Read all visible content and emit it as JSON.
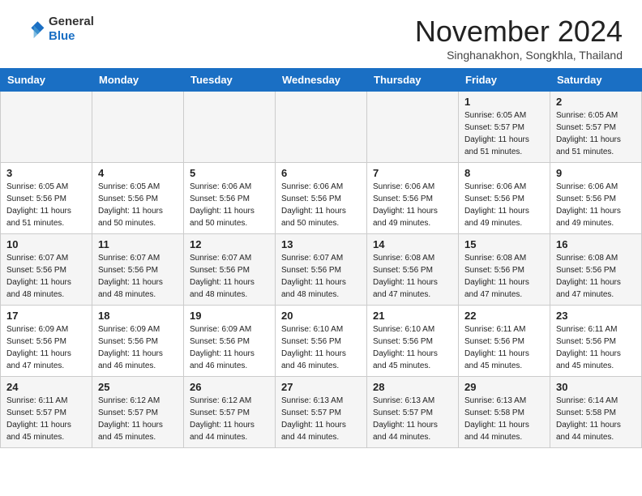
{
  "header": {
    "logo_line1": "General",
    "logo_line2": "Blue",
    "month_title": "November 2024",
    "subtitle": "Singhanakhon, Songkhla, Thailand"
  },
  "weekdays": [
    "Sunday",
    "Monday",
    "Tuesday",
    "Wednesday",
    "Thursday",
    "Friday",
    "Saturday"
  ],
  "weeks": [
    [
      {
        "day": "",
        "info": ""
      },
      {
        "day": "",
        "info": ""
      },
      {
        "day": "",
        "info": ""
      },
      {
        "day": "",
        "info": ""
      },
      {
        "day": "",
        "info": ""
      },
      {
        "day": "1",
        "info": "Sunrise: 6:05 AM\nSunset: 5:57 PM\nDaylight: 11 hours\nand 51 minutes."
      },
      {
        "day": "2",
        "info": "Sunrise: 6:05 AM\nSunset: 5:57 PM\nDaylight: 11 hours\nand 51 minutes."
      }
    ],
    [
      {
        "day": "3",
        "info": "Sunrise: 6:05 AM\nSunset: 5:56 PM\nDaylight: 11 hours\nand 51 minutes."
      },
      {
        "day": "4",
        "info": "Sunrise: 6:05 AM\nSunset: 5:56 PM\nDaylight: 11 hours\nand 50 minutes."
      },
      {
        "day": "5",
        "info": "Sunrise: 6:06 AM\nSunset: 5:56 PM\nDaylight: 11 hours\nand 50 minutes."
      },
      {
        "day": "6",
        "info": "Sunrise: 6:06 AM\nSunset: 5:56 PM\nDaylight: 11 hours\nand 50 minutes."
      },
      {
        "day": "7",
        "info": "Sunrise: 6:06 AM\nSunset: 5:56 PM\nDaylight: 11 hours\nand 49 minutes."
      },
      {
        "day": "8",
        "info": "Sunrise: 6:06 AM\nSunset: 5:56 PM\nDaylight: 11 hours\nand 49 minutes."
      },
      {
        "day": "9",
        "info": "Sunrise: 6:06 AM\nSunset: 5:56 PM\nDaylight: 11 hours\nand 49 minutes."
      }
    ],
    [
      {
        "day": "10",
        "info": "Sunrise: 6:07 AM\nSunset: 5:56 PM\nDaylight: 11 hours\nand 48 minutes."
      },
      {
        "day": "11",
        "info": "Sunrise: 6:07 AM\nSunset: 5:56 PM\nDaylight: 11 hours\nand 48 minutes."
      },
      {
        "day": "12",
        "info": "Sunrise: 6:07 AM\nSunset: 5:56 PM\nDaylight: 11 hours\nand 48 minutes."
      },
      {
        "day": "13",
        "info": "Sunrise: 6:07 AM\nSunset: 5:56 PM\nDaylight: 11 hours\nand 48 minutes."
      },
      {
        "day": "14",
        "info": "Sunrise: 6:08 AM\nSunset: 5:56 PM\nDaylight: 11 hours\nand 47 minutes."
      },
      {
        "day": "15",
        "info": "Sunrise: 6:08 AM\nSunset: 5:56 PM\nDaylight: 11 hours\nand 47 minutes."
      },
      {
        "day": "16",
        "info": "Sunrise: 6:08 AM\nSunset: 5:56 PM\nDaylight: 11 hours\nand 47 minutes."
      }
    ],
    [
      {
        "day": "17",
        "info": "Sunrise: 6:09 AM\nSunset: 5:56 PM\nDaylight: 11 hours\nand 47 minutes."
      },
      {
        "day": "18",
        "info": "Sunrise: 6:09 AM\nSunset: 5:56 PM\nDaylight: 11 hours\nand 46 minutes."
      },
      {
        "day": "19",
        "info": "Sunrise: 6:09 AM\nSunset: 5:56 PM\nDaylight: 11 hours\nand 46 minutes."
      },
      {
        "day": "20",
        "info": "Sunrise: 6:10 AM\nSunset: 5:56 PM\nDaylight: 11 hours\nand 46 minutes."
      },
      {
        "day": "21",
        "info": "Sunrise: 6:10 AM\nSunset: 5:56 PM\nDaylight: 11 hours\nand 45 minutes."
      },
      {
        "day": "22",
        "info": "Sunrise: 6:11 AM\nSunset: 5:56 PM\nDaylight: 11 hours\nand 45 minutes."
      },
      {
        "day": "23",
        "info": "Sunrise: 6:11 AM\nSunset: 5:56 PM\nDaylight: 11 hours\nand 45 minutes."
      }
    ],
    [
      {
        "day": "24",
        "info": "Sunrise: 6:11 AM\nSunset: 5:57 PM\nDaylight: 11 hours\nand 45 minutes."
      },
      {
        "day": "25",
        "info": "Sunrise: 6:12 AM\nSunset: 5:57 PM\nDaylight: 11 hours\nand 45 minutes."
      },
      {
        "day": "26",
        "info": "Sunrise: 6:12 AM\nSunset: 5:57 PM\nDaylight: 11 hours\nand 44 minutes."
      },
      {
        "day": "27",
        "info": "Sunrise: 6:13 AM\nSunset: 5:57 PM\nDaylight: 11 hours\nand 44 minutes."
      },
      {
        "day": "28",
        "info": "Sunrise: 6:13 AM\nSunset: 5:57 PM\nDaylight: 11 hours\nand 44 minutes."
      },
      {
        "day": "29",
        "info": "Sunrise: 6:13 AM\nSunset: 5:58 PM\nDaylight: 11 hours\nand 44 minutes."
      },
      {
        "day": "30",
        "info": "Sunrise: 6:14 AM\nSunset: 5:58 PM\nDaylight: 11 hours\nand 44 minutes."
      }
    ]
  ]
}
